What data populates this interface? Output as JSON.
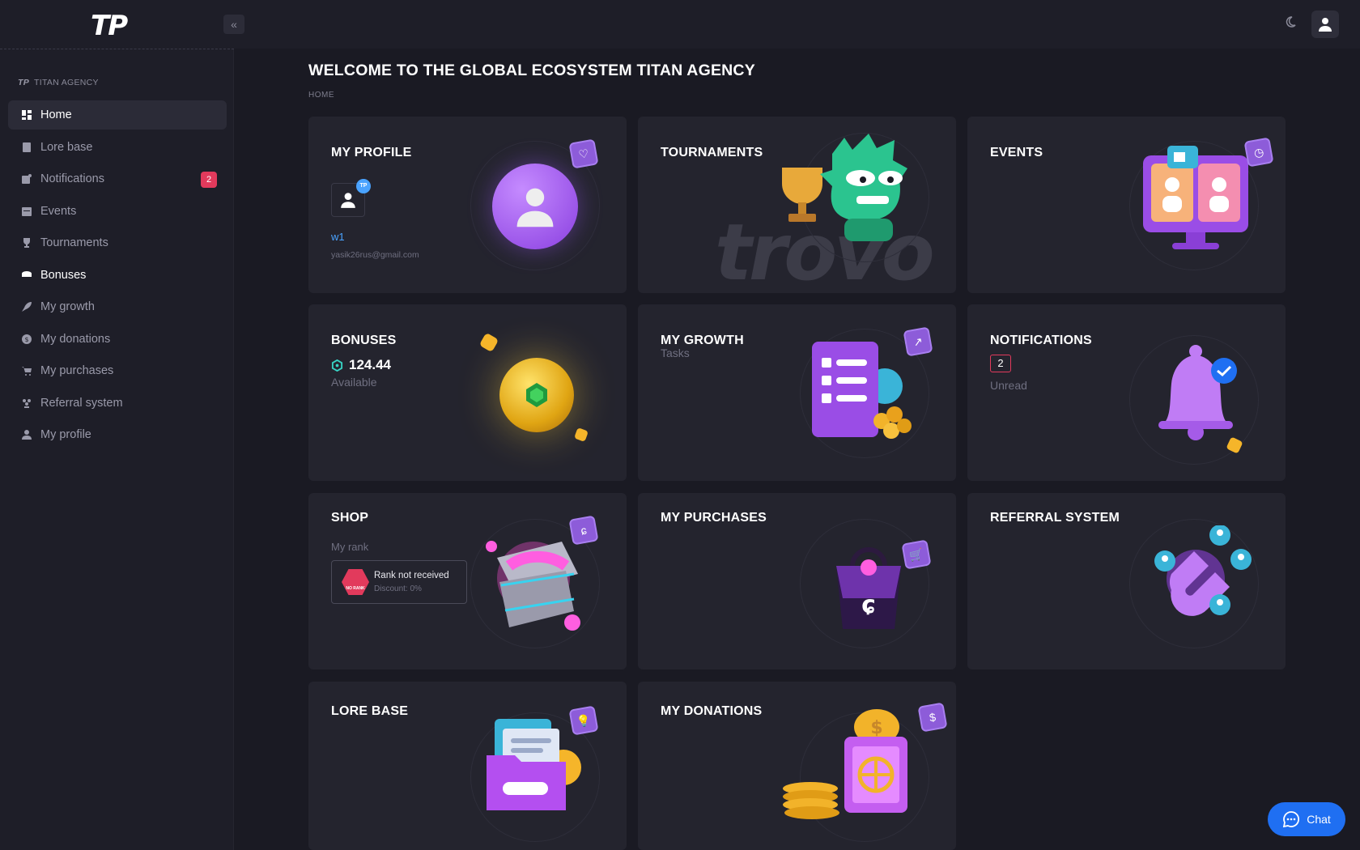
{
  "app": {
    "logo": "TP"
  },
  "sidebar": {
    "section_label": "TITAN AGENCY",
    "section_logo": "TP",
    "items": [
      {
        "label": "Home",
        "icon": "dashboard-icon",
        "active": true
      },
      {
        "label": "Lore base",
        "icon": "book-icon"
      },
      {
        "label": "Notifications",
        "icon": "notification-icon",
        "badge": "2"
      },
      {
        "label": "Events",
        "icon": "calendar-icon"
      },
      {
        "label": "Tournaments",
        "icon": "trophy-icon"
      },
      {
        "label": "Bonuses",
        "icon": "coin-stack-icon"
      },
      {
        "label": "My growth",
        "icon": "rocket-icon"
      },
      {
        "label": "My donations",
        "icon": "dollar-icon"
      },
      {
        "label": "My purchases",
        "icon": "cart-icon"
      },
      {
        "label": "Referral system",
        "icon": "users-icon"
      },
      {
        "label": "My profile",
        "icon": "user-icon"
      }
    ]
  },
  "header": {
    "title": "WELCOME TO THE GLOBAL ECOSYSTEM TITAN AGENCY",
    "breadcrumb": "HOME"
  },
  "cards": {
    "profile": {
      "title": "MY PROFILE",
      "username": "w1",
      "email": "yasik26rus@gmail.com",
      "avatar_badge": "TP"
    },
    "tournaments": {
      "title": "TOURNAMENTS",
      "watermark": "trovo"
    },
    "events": {
      "title": "EVENTS"
    },
    "bonuses": {
      "title": "BONUSES",
      "amount": "124.44",
      "status": "Available"
    },
    "growth": {
      "title": "MY GROWTH",
      "subtitle": "Tasks"
    },
    "notifications": {
      "title": "NOTIFICATIONS",
      "count": "2",
      "status": "Unread"
    },
    "shop": {
      "title": "SHOP",
      "rank_label": "My rank",
      "rank_status": "Rank not received",
      "discount": "Discount: 0%",
      "rank_badge": "NO RANK"
    },
    "purchases": {
      "title": "MY PURCHASES"
    },
    "referral": {
      "title": "REFERRAL SYSTEM"
    },
    "lore": {
      "title": "LORE BASE"
    },
    "donations": {
      "title": "MY DONATIONS"
    }
  },
  "chat": {
    "label": "Chat"
  },
  "colors": {
    "accent_purple": "#8d5cd9",
    "badge_red": "#e23a5c",
    "chat_blue": "#1f6ff2",
    "link_blue": "#4aa3ff",
    "bonus_teal": "#38d3c4"
  }
}
